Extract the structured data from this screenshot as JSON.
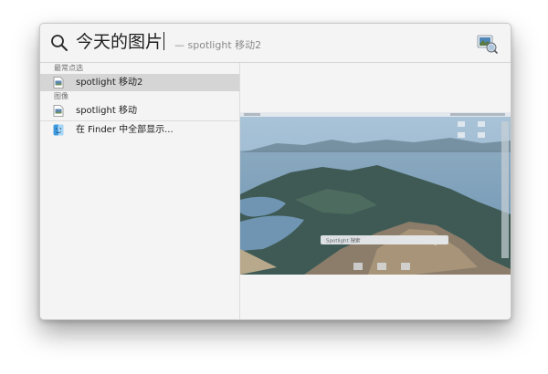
{
  "search": {
    "query": "今天的图片",
    "completion_hint": "— spotlight 移动2"
  },
  "sections": [
    {
      "header": "最常点选",
      "items": [
        {
          "label": "spotlight 移动2",
          "icon": "image-file-icon",
          "selected": true
        }
      ]
    },
    {
      "header": "图像",
      "items": [
        {
          "label": "spotlight 移动",
          "icon": "image-file-icon",
          "selected": false
        }
      ]
    }
  ],
  "finder_item": {
    "label": "在 Finder 中全部显示...",
    "icon": "finder-icon"
  },
  "preview": {
    "spotlight_placeholder": "Spotlight 搜索",
    "app_icon": "preview-app-icon"
  },
  "colors": {
    "selection": "#d5d5d5",
    "window_bg": "#f4f4f4"
  }
}
